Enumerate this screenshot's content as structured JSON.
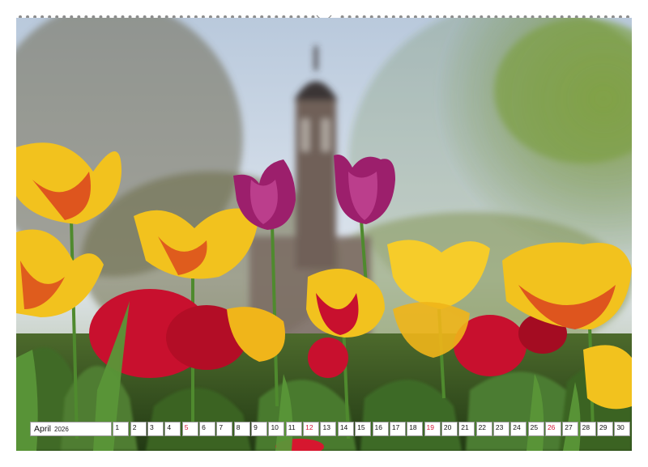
{
  "calendar": {
    "month": "April",
    "year": "2026",
    "days": [
      {
        "n": "1",
        "sun": false
      },
      {
        "n": "2",
        "sun": false
      },
      {
        "n": "3",
        "sun": false
      },
      {
        "n": "4",
        "sun": false
      },
      {
        "n": "5",
        "sun": true
      },
      {
        "n": "6",
        "sun": false
      },
      {
        "n": "7",
        "sun": false
      },
      {
        "n": "8",
        "sun": false
      },
      {
        "n": "9",
        "sun": false
      },
      {
        "n": "10",
        "sun": false
      },
      {
        "n": "11",
        "sun": false
      },
      {
        "n": "12",
        "sun": true
      },
      {
        "n": "13",
        "sun": false
      },
      {
        "n": "14",
        "sun": false
      },
      {
        "n": "15",
        "sun": false
      },
      {
        "n": "16",
        "sun": false
      },
      {
        "n": "17",
        "sun": false
      },
      {
        "n": "18",
        "sun": false
      },
      {
        "n": "19",
        "sun": true
      },
      {
        "n": "20",
        "sun": false
      },
      {
        "n": "21",
        "sun": false
      },
      {
        "n": "22",
        "sun": false
      },
      {
        "n": "23",
        "sun": false
      },
      {
        "n": "24",
        "sun": false
      },
      {
        "n": "25",
        "sun": false
      },
      {
        "n": "26",
        "sun": true
      },
      {
        "n": "27",
        "sun": false
      },
      {
        "n": "28",
        "sun": false
      },
      {
        "n": "29",
        "sun": false
      },
      {
        "n": "30",
        "sun": false
      }
    ]
  },
  "colors": {
    "sunday": "#d4183a",
    "tulip_yellow": "#f2c21e",
    "tulip_red": "#c8102e",
    "tulip_purple": "#9c1f6c",
    "sky": "#c9d6e6"
  }
}
